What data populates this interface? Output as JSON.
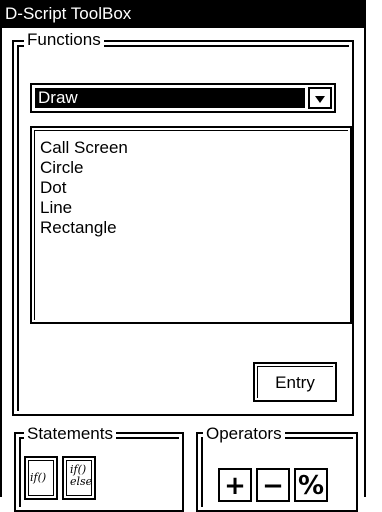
{
  "window": {
    "title": "D-Script ToolBox"
  },
  "functions": {
    "legend": "Functions",
    "dropdown_value": "Draw",
    "list_items": [
      "Call Screen",
      "Circle",
      "Dot",
      "Line",
      "Rectangle"
    ],
    "entry_label": "Entry"
  },
  "statements": {
    "legend": "Statements",
    "buttons": [
      {
        "line1": "if()"
      },
      {
        "line1": "if()",
        "line2": "else"
      }
    ]
  },
  "operators": {
    "legend": "Operators",
    "buttons": [
      "+",
      "−",
      "%"
    ]
  },
  "icons": {
    "dropdown_arrow": "chevron-down-icon"
  }
}
